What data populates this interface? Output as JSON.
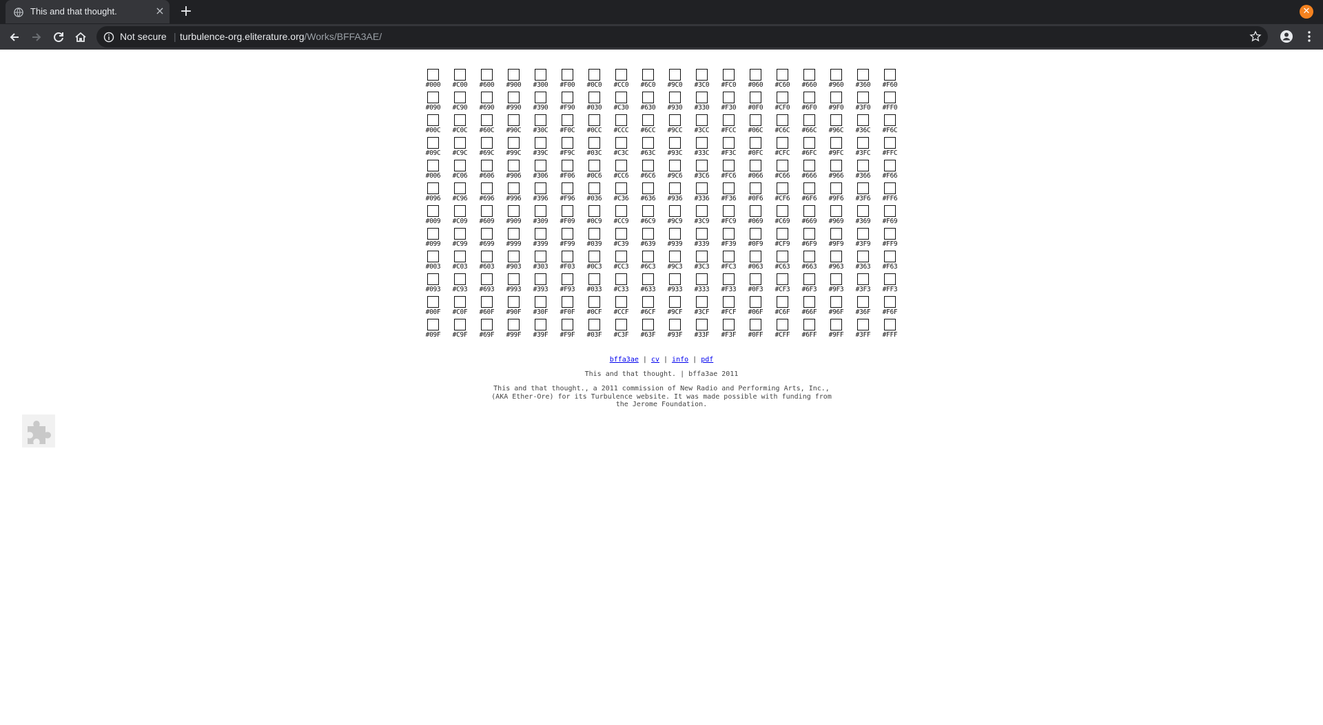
{
  "browser": {
    "tab_title": "This and that thought.",
    "close_tab": "×",
    "new_tab": "+",
    "security_label": "Not secure",
    "url_host": "turbulence-org.eliterature.org",
    "url_path": "/Works/BFFA3AE/"
  },
  "swatches": [
    "#000",
    "#C00",
    "#600",
    "#900",
    "#300",
    "#F00",
    "#0C0",
    "#CC0",
    "#6C0",
    "#9C0",
    "#3C0",
    "#FC0",
    "#060",
    "#C60",
    "#660",
    "#960",
    "#360",
    "#F60",
    "#090",
    "#C90",
    "#690",
    "#990",
    "#390",
    "#F90",
    "#030",
    "#C30",
    "#630",
    "#930",
    "#330",
    "#F30",
    "#0F0",
    "#CF0",
    "#6F0",
    "#9F0",
    "#3F0",
    "#FF0",
    "#00C",
    "#C0C",
    "#60C",
    "#90C",
    "#30C",
    "#F0C",
    "#0CC",
    "#CCC",
    "#6CC",
    "#9CC",
    "#3CC",
    "#FCC",
    "#06C",
    "#C6C",
    "#66C",
    "#96C",
    "#36C",
    "#F6C",
    "#09C",
    "#C9C",
    "#69C",
    "#99C",
    "#39C",
    "#F9C",
    "#03C",
    "#C3C",
    "#63C",
    "#93C",
    "#33C",
    "#F3C",
    "#0FC",
    "#CFC",
    "#6FC",
    "#9FC",
    "#3FC",
    "#FFC",
    "#006",
    "#C06",
    "#606",
    "#906",
    "#306",
    "#F06",
    "#0C6",
    "#CC6",
    "#6C6",
    "#9C6",
    "#3C6",
    "#FC6",
    "#066",
    "#C66",
    "#666",
    "#966",
    "#366",
    "#F66",
    "#096",
    "#C96",
    "#696",
    "#996",
    "#396",
    "#F96",
    "#036",
    "#C36",
    "#636",
    "#936",
    "#336",
    "#F36",
    "#0F6",
    "#CF6",
    "#6F6",
    "#9F6",
    "#3F6",
    "#FF6",
    "#009",
    "#C09",
    "#609",
    "#909",
    "#309",
    "#F09",
    "#0C9",
    "#CC9",
    "#6C9",
    "#9C9",
    "#3C9",
    "#FC9",
    "#069",
    "#C69",
    "#669",
    "#969",
    "#369",
    "#F69",
    "#099",
    "#C99",
    "#699",
    "#999",
    "#399",
    "#F99",
    "#039",
    "#C39",
    "#639",
    "#939",
    "#339",
    "#F39",
    "#0F9",
    "#CF9",
    "#6F9",
    "#9F9",
    "#3F9",
    "#FF9",
    "#003",
    "#C03",
    "#603",
    "#903",
    "#303",
    "#F03",
    "#0C3",
    "#CC3",
    "#6C3",
    "#9C3",
    "#3C3",
    "#FC3",
    "#063",
    "#C63",
    "#663",
    "#963",
    "#363",
    "#F63",
    "#093",
    "#C93",
    "#693",
    "#993",
    "#393",
    "#F93",
    "#033",
    "#C33",
    "#633",
    "#933",
    "#333",
    "#F33",
    "#0F3",
    "#CF3",
    "#6F3",
    "#9F3",
    "#3F3",
    "#FF3",
    "#00F",
    "#C0F",
    "#60F",
    "#90F",
    "#30F",
    "#F0F",
    "#0CF",
    "#CCF",
    "#6CF",
    "#9CF",
    "#3CF",
    "#FCF",
    "#06F",
    "#C6F",
    "#66F",
    "#96F",
    "#36F",
    "#F6F",
    "#09F",
    "#C9F",
    "#69F",
    "#99F",
    "#39F",
    "#F9F",
    "#03F",
    "#C3F",
    "#63F",
    "#93F",
    "#33F",
    "#F3F",
    "#0FF",
    "#CFF",
    "#6FF",
    "#9FF",
    "#3FF",
    "#FFF"
  ],
  "footer": {
    "links": [
      "bffa3ae",
      "cv",
      "info",
      "pdf"
    ],
    "separator": " | ",
    "credit_line": "This and that thought. | bffa3ae 2011",
    "commission_text": "This and that thought., a 2011 commission of New Radio and Performing Arts, Inc., (AKA Ether-Ore) for its Turbulence website. It was made possible with funding from the Jerome Foundation."
  },
  "colors": {
    "chrome_dark": "#202124",
    "chrome_tab": "#35363a",
    "window_close": "#f5821f",
    "link": "#0000ee"
  }
}
